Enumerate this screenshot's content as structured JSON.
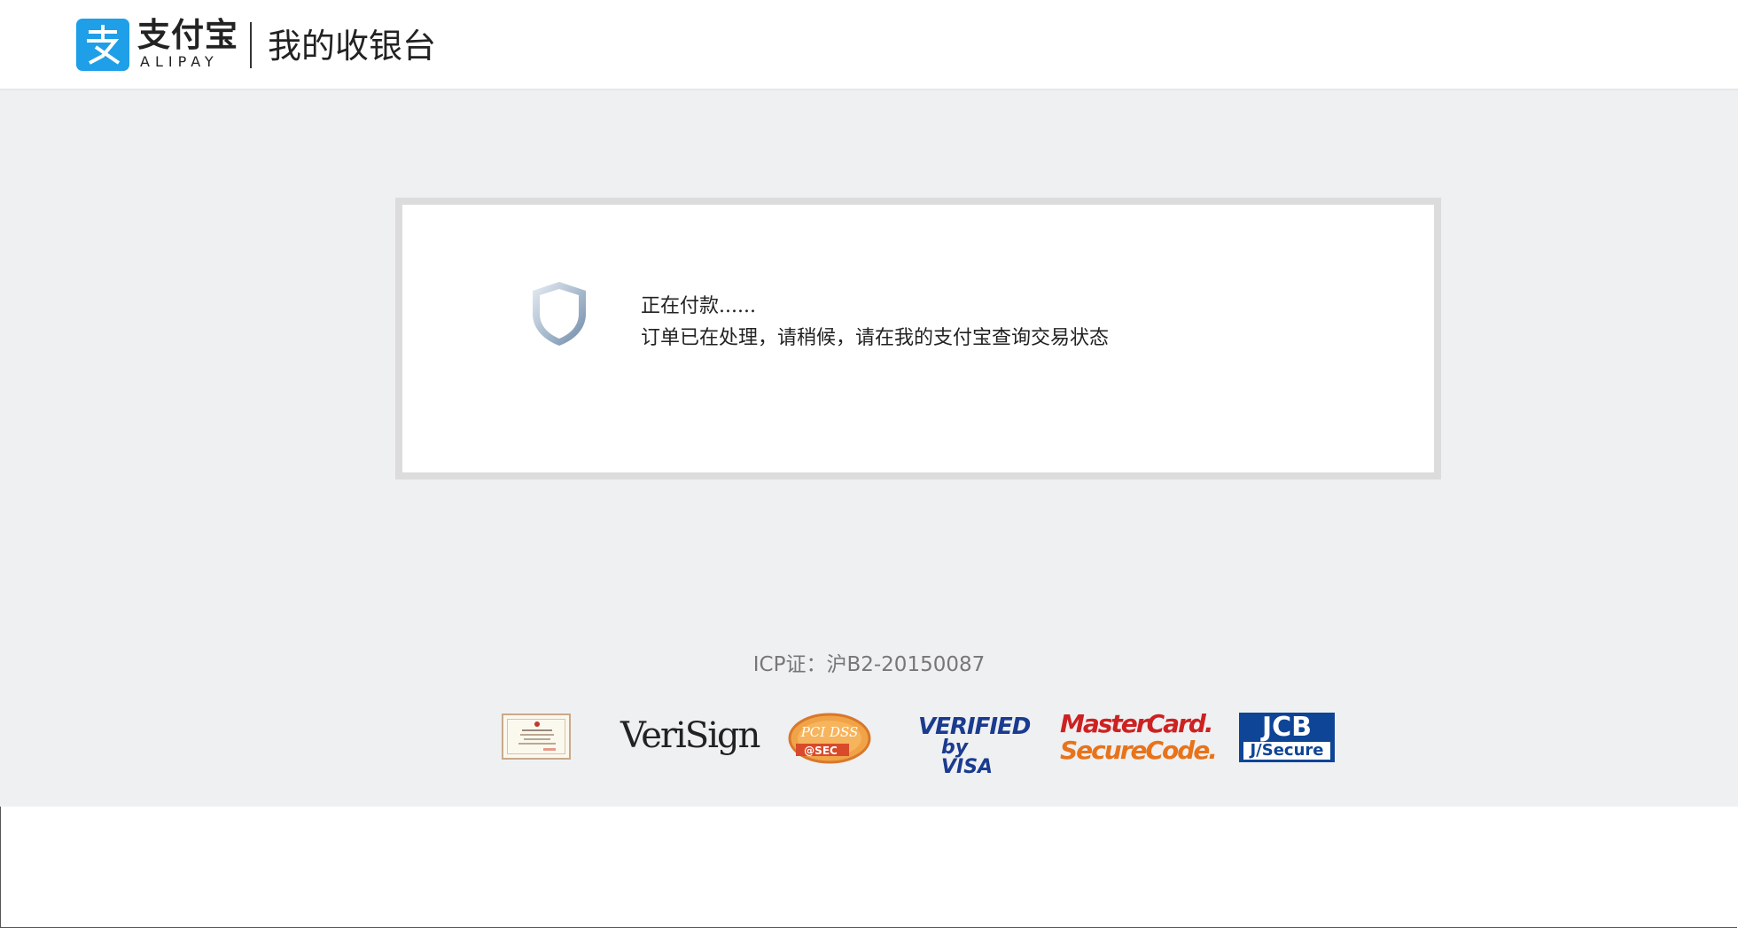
{
  "header": {
    "brand_cn": "支付宝",
    "brand_en": "ALIPAY",
    "title": "我的收银台",
    "logo_color": "#1e9fe8"
  },
  "status": {
    "line1": "正在付款......",
    "line2": "订单已在处理，请稍候，请在我的支付宝查询交易状态",
    "icon": "shield-icon"
  },
  "footer": {
    "icp": "ICP证：沪B2-20150087",
    "badges": {
      "verisign": "VeriSign",
      "pci": "PCI DSS",
      "pci_sub": "@SEC",
      "vbv_line1": "VERIFIED",
      "vbv_line2": "by VISA",
      "mc_line1": "MasterCard.",
      "mc_line2": "SecureCode.",
      "jcb_line1": "JCB",
      "jcb_line2": "J/Secure"
    }
  },
  "colors": {
    "page_bg": "#eff0f2",
    "card_border": "#dcdcdc",
    "accent": "#1e9fe8"
  }
}
